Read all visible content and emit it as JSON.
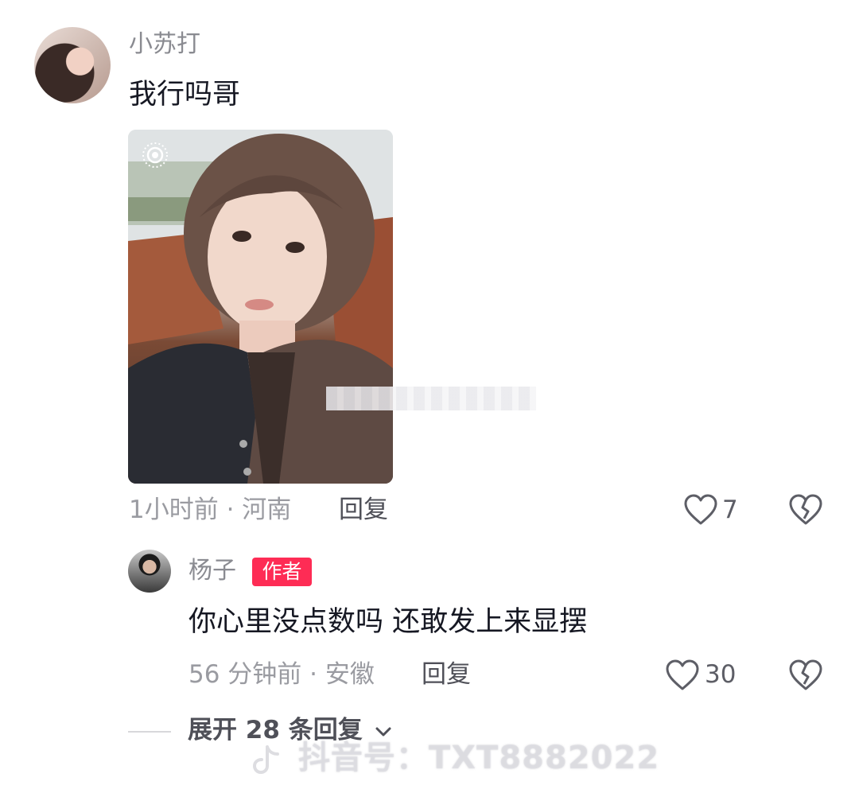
{
  "comment": {
    "username": "小苏打",
    "text": "我行吗哥",
    "meta": "1小时前 · 河南",
    "reply_label": "回复",
    "like_count": "7"
  },
  "reply": {
    "username": "杨子",
    "badge": "作者",
    "text": "你心里没点数吗 还敢发上来显摆",
    "meta": "56 分钟前 · 安徽",
    "reply_label": "回复",
    "like_count": "30"
  },
  "expand": {
    "label": "展开 28 条回复"
  },
  "watermark": {
    "text": "抖音号：TXT8882022"
  },
  "icons": {
    "like": "heart-outline-icon",
    "dislike": "broken-heart-icon",
    "live_photo": "live-photo-icon",
    "chevron": "chevron-down-icon"
  },
  "colors": {
    "author_badge": "#fe2c55",
    "username": "#8a8b91",
    "meta": "#9a9ba1"
  }
}
